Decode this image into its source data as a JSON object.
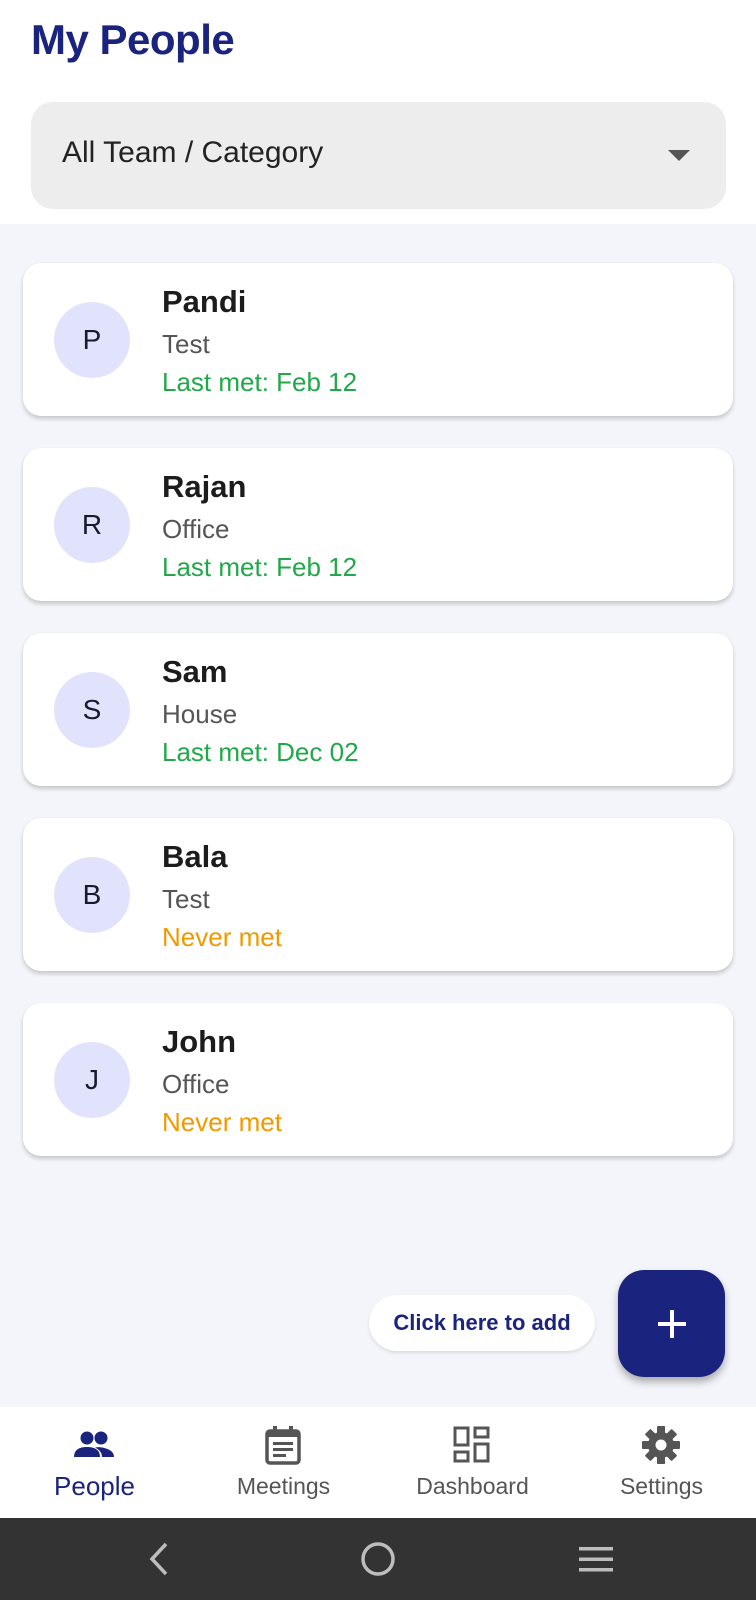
{
  "header": {
    "title": "My People",
    "filter": {
      "selected": "All Team / Category"
    }
  },
  "people": [
    {
      "initial": "P",
      "name": "Pandi",
      "category": "Test",
      "status": "Last met: Feb 12",
      "status_type": "met"
    },
    {
      "initial": "R",
      "name": "Rajan",
      "category": "Office",
      "status": "Last met: Feb 12",
      "status_type": "met"
    },
    {
      "initial": "S",
      "name": "Sam",
      "category": "House",
      "status": "Last met: Dec 02",
      "status_type": "met"
    },
    {
      "initial": "B",
      "name": "Bala",
      "category": "Test",
      "status": "Never met",
      "status_type": "never"
    },
    {
      "initial": "J",
      "name": "John",
      "category": "Office",
      "status": "Never met",
      "status_type": "never"
    }
  ],
  "add": {
    "hint": "Click here to add",
    "fab_icon": "plus-icon"
  },
  "nav": {
    "items": [
      {
        "label": "People",
        "icon": "people-icon",
        "active": true
      },
      {
        "label": "Meetings",
        "icon": "calendar-icon",
        "active": false
      },
      {
        "label": "Dashboard",
        "icon": "dashboard-icon",
        "active": false
      },
      {
        "label": "Settings",
        "icon": "gear-icon",
        "active": false
      }
    ]
  },
  "system_nav": {
    "buttons": [
      "back-icon",
      "home-icon",
      "recents-icon"
    ]
  },
  "colors": {
    "primary": "#1a237e",
    "met_status": "#22a84a",
    "never_status": "#f09a00",
    "avatar_bg": "#e1e3fc",
    "page_bg": "#f3f5fa"
  }
}
